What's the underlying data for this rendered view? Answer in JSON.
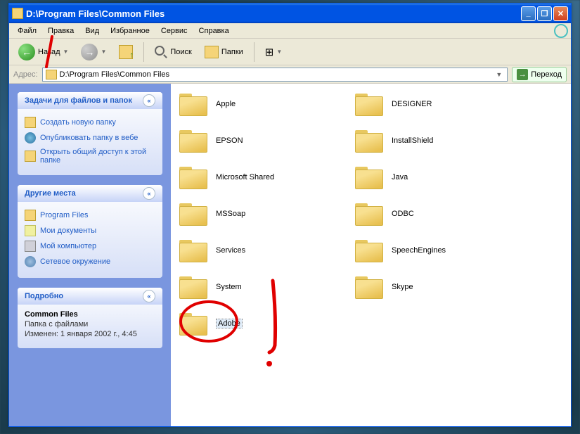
{
  "title": "D:\\Program Files\\Common Files",
  "menu": {
    "file": "Файл",
    "edit": "Правка",
    "view": "Вид",
    "favorites": "Избранное",
    "tools": "Сервис",
    "help": "Справка"
  },
  "toolbar": {
    "back": "Назад",
    "search": "Поиск",
    "folders": "Папки"
  },
  "addressbar": {
    "label": "Адрес:",
    "path": "D:\\Program Files\\Common Files",
    "go": "Переход"
  },
  "panels": {
    "tasks": {
      "title": "Задачи для файлов и папок",
      "links": {
        "new_folder": "Создать новую папку",
        "publish": "Опубликовать папку в вебе",
        "share": "Открыть общий доступ к этой папке"
      }
    },
    "places": {
      "title": "Другие места",
      "links": {
        "program_files": "Program Files",
        "my_docs": "Мои документы",
        "my_computer": "Мой компьютер",
        "network": "Сетевое окружение"
      }
    },
    "details": {
      "title": "Подробно",
      "name": "Common Files",
      "type": "Папка с файлами",
      "modified": "Изменен: 1 января 2002 г., 4:45"
    }
  },
  "folders": [
    {
      "name": "Apple"
    },
    {
      "name": "DESIGNER"
    },
    {
      "name": "EPSON"
    },
    {
      "name": "InstallShield"
    },
    {
      "name": "Microsoft Shared"
    },
    {
      "name": "Java"
    },
    {
      "name": "MSSoap"
    },
    {
      "name": "ODBC"
    },
    {
      "name": "Services"
    },
    {
      "name": "SpeechEngines"
    },
    {
      "name": "System"
    },
    {
      "name": "Skype"
    },
    {
      "name": "Adobe",
      "selected": true
    }
  ]
}
